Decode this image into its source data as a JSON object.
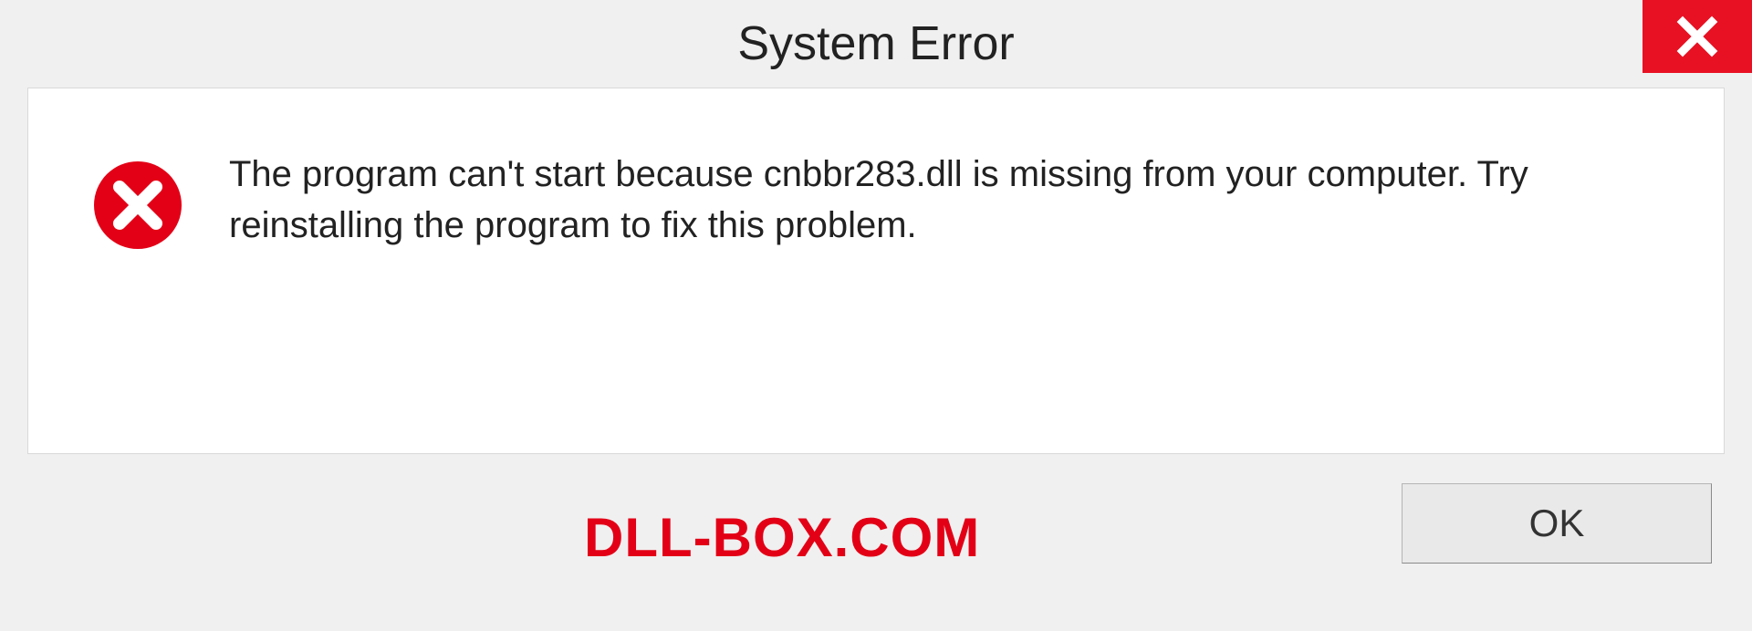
{
  "dialog": {
    "title": "System Error",
    "message": "The program can't start because cnbbr283.dll is missing from your computer. Try reinstalling the program to fix this problem.",
    "ok_label": "OK"
  },
  "watermark": "DLL-BOX.COM",
  "icons": {
    "close": "close-icon",
    "error": "error-circle-x-icon"
  },
  "colors": {
    "close_bg": "#e81123",
    "error_red": "#e30016",
    "panel_bg": "#ffffff",
    "window_bg": "#f0f0f0"
  }
}
